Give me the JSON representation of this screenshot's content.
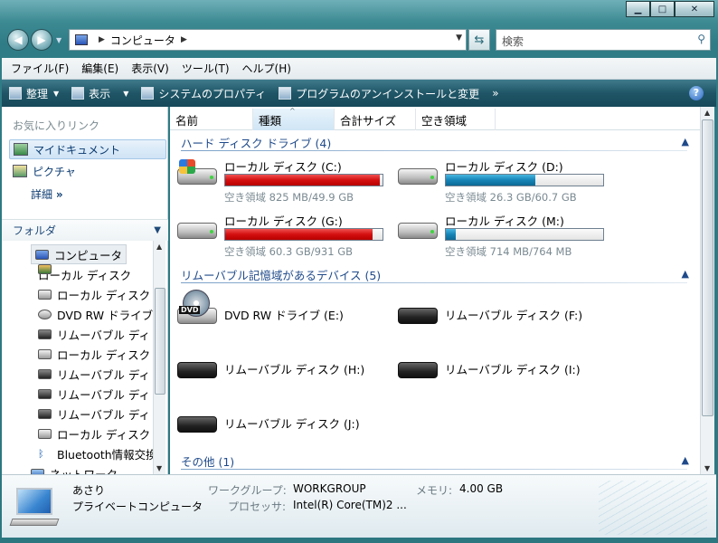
{
  "window": {
    "min": "▁",
    "max": "□",
    "close": "✕"
  },
  "address": {
    "location": "コンピュータ",
    "search_placeholder": "検索"
  },
  "menu": [
    "ファイル(F)",
    "編集(E)",
    "表示(V)",
    "ツール(T)",
    "ヘルプ(H)"
  ],
  "toolbar": {
    "organize": "整理",
    "view": "表示",
    "properties": "システムのプロパティ",
    "uninstall": "プログラムのアンインストールと変更",
    "more": "»"
  },
  "left": {
    "favorites_title": "お気に入りリンク",
    "links": [
      "マイドキュメント",
      "ピクチャ"
    ],
    "detail": "詳細",
    "folders_title": "フォルダ",
    "tree": [
      "コンピュータ",
      "ローカル ディスク",
      "ローカル ディスク",
      "DVD RW ドライブ",
      "リムーバブル ディ",
      "ローカル ディスク",
      "リムーバブル ディ",
      "リムーバブル ディ",
      "リムーバブル ディ",
      "ローカル ディスク",
      "Bluetooth情報交換",
      "ネットワーク"
    ]
  },
  "columns": [
    "名前",
    "種類",
    "合計サイズ",
    "空き領域"
  ],
  "groups": {
    "hdd": "ハード ディスク ドライブ (4)",
    "removable": "リムーバブル記憶域があるデバイス (5)",
    "other": "その他 (1)"
  },
  "hdd": [
    {
      "name": "ローカル ディスク (C:)",
      "free": "空き領域 825 MB/49.9 GB",
      "used": 0.984,
      "color": "red"
    },
    {
      "name": "ローカル ディスク (D:)",
      "free": "空き領域 26.3 GB/60.7 GB",
      "used": 0.567,
      "color": "blue"
    },
    {
      "name": "ローカル ディスク (G:)",
      "free": "空き領域 60.3 GB/931 GB",
      "used": 0.935,
      "color": "red"
    },
    {
      "name": "ローカル ディスク (M:)",
      "free": "空き領域 714 MB/764 MB",
      "used": 0.065,
      "color": "blue"
    }
  ],
  "removable": [
    "DVD RW ドライブ (E:)",
    "リムーバブル ディスク (F:)",
    "リムーバブル ディスク (H:)",
    "リムーバブル ディスク (I:)",
    "リムーバブル ディスク (J:)"
  ],
  "status": {
    "computer_name": "あさり",
    "computer_type": "プライベートコンピュータ",
    "workgroup_label": "ワークグループ:",
    "workgroup": "WORKGROUP",
    "memory_label": "メモリ:",
    "memory": "4.00 GB",
    "processor_label": "プロセッサ:",
    "processor": "Intel(R) Core(TM)2 ..."
  }
}
